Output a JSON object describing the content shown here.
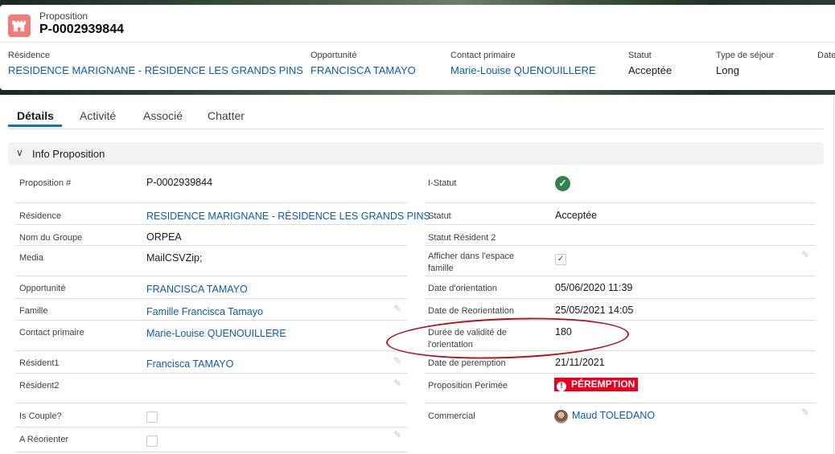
{
  "header": {
    "object_label": "Proposition",
    "record_name": "P-0002939844",
    "fields": [
      {
        "label": "Résidence",
        "value": "RESIDENCE MARIGNANE - RÉSIDENCE LES GRANDS PINS",
        "link": true
      },
      {
        "label": "Opportunité",
        "value": "FRANCISCA TAMAYO",
        "link": true
      },
      {
        "label": "Contact primaire",
        "value": "Marie-Louise QUENOUILLERE",
        "link": true
      },
      {
        "label": "Statut",
        "value": "Acceptée",
        "link": false
      },
      {
        "label": "Type de séjour",
        "value": "Long",
        "link": false
      },
      {
        "label": "Date",
        "value": "",
        "link": false
      }
    ]
  },
  "tabs": [
    "Détails",
    "Activité",
    "Associé",
    "Chatter"
  ],
  "active_tab": "Détails",
  "section": {
    "title": "Info Proposition",
    "icon": "chevron-down-icon"
  },
  "left_fields": {
    "proposition_num": {
      "label": "Proposition #",
      "value": "P-0002939844"
    },
    "residence": {
      "label": "Résidence",
      "value": "RESIDENCE MARIGNANE - RÉSIDENCE LES GRANDS PINS"
    },
    "nom_groupe": {
      "label": "Nom du Groupe",
      "value": "ORPEA"
    },
    "media": {
      "label": "Media",
      "value": "MailCSVZip;"
    },
    "opportunite": {
      "label": "Opportunité",
      "value": "FRANCISCA TAMAYO"
    },
    "famille": {
      "label": "Famille",
      "value": "Famille Francisca Tamayo"
    },
    "contact_primaire": {
      "label": "Contact primaire",
      "value": "Marie-Louise QUENOUILLERE"
    },
    "resident1": {
      "label": "Résident1",
      "value": "Francisca TAMAYO"
    },
    "resident2": {
      "label": "Résident2",
      "value": ""
    },
    "is_couple": {
      "label": "Is Couple?",
      "checked": false
    },
    "a_reorienter": {
      "label": "A Réorienter",
      "checked": false
    }
  },
  "right_fields": {
    "i_statut": {
      "label": "I-Statut",
      "icon": "check-circle-icon"
    },
    "statut": {
      "label": "Statut",
      "value": "Acceptée"
    },
    "statut_resident2": {
      "label": "Statut Résident 2",
      "value": ""
    },
    "afficher": {
      "label": "Afficher dans l'espace famille",
      "checked": true
    },
    "date_orientation": {
      "label": "Date d'orientation",
      "value": "05/06/2020 11:39"
    },
    "date_reorientation": {
      "label": "Date de Reorientation",
      "value": "25/05/2021 14:05"
    },
    "duree_validite": {
      "label": "Durée de validité de l'orientation",
      "value": "180"
    },
    "date_peremption": {
      "label": "Date de peremption",
      "value": "21/11/2021"
    },
    "proposition_perimee": {
      "label": "Proposition Perimée",
      "badge": "PÉREMPTION",
      "badge_color": "#ea001e"
    },
    "commercial": {
      "label": "Commercial",
      "value": "Maud TOLEDANO"
    }
  },
  "colors": {
    "link": "#0b5cab",
    "brand": "#0176d3",
    "object_icon": "#f17c7a",
    "annotation": "#b5121b"
  }
}
